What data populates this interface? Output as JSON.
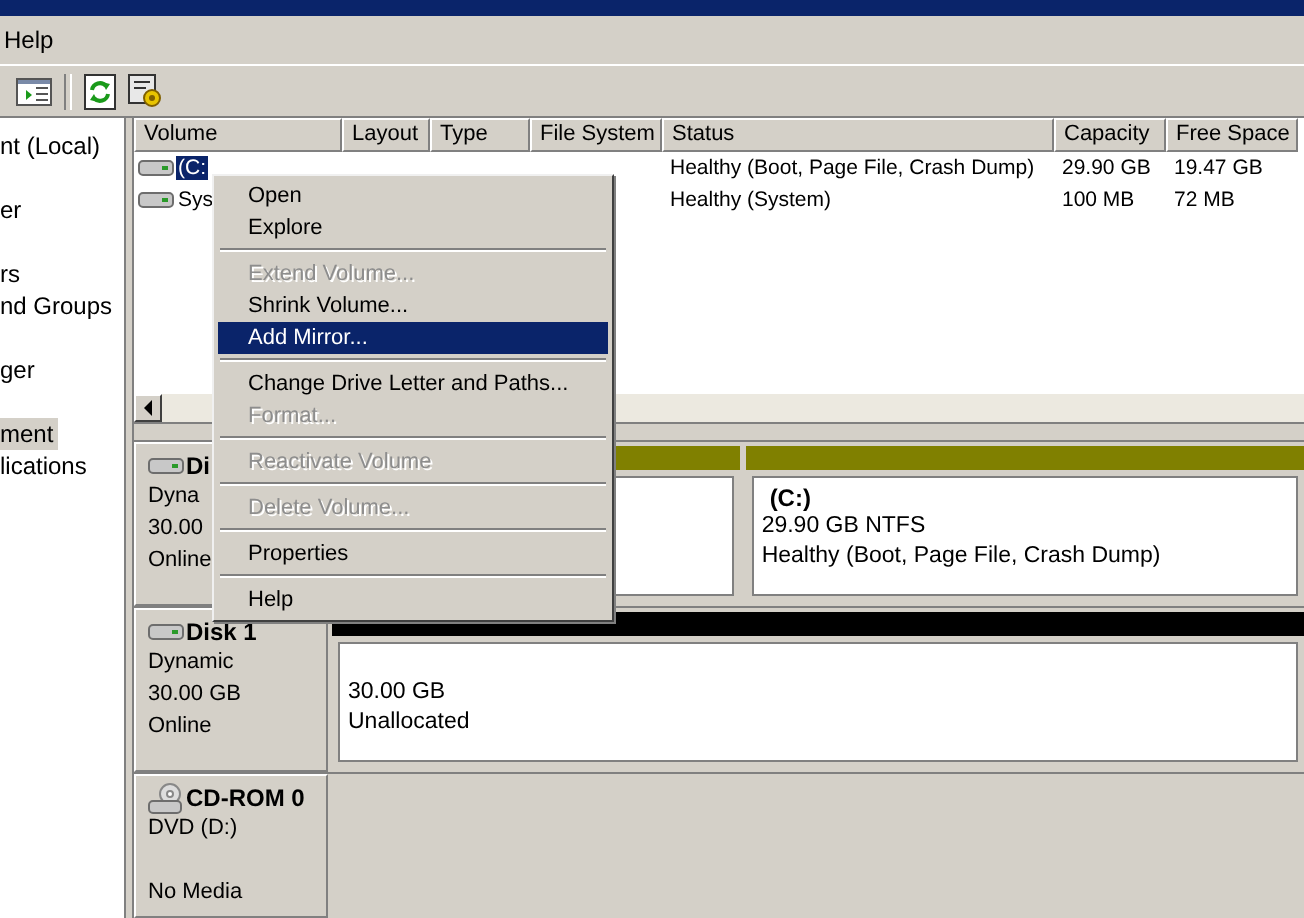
{
  "menu_bar": [
    "Help"
  ],
  "tree": [
    {
      "label": "nt (Local)",
      "selected": false
    },
    {
      "label": "er",
      "selected": false
    },
    {
      "label": "rs",
      "selected": false
    },
    {
      "label": "nd Groups",
      "selected": false
    },
    {
      "label": "ger",
      "selected": false
    },
    {
      "label": "ment",
      "selected": true
    },
    {
      "label": "lications",
      "selected": false
    }
  ],
  "table": {
    "columns": [
      "Volume",
      "Layout",
      "Type",
      "File System",
      "Status",
      "Capacity",
      "Free Space"
    ],
    "rows": [
      {
        "volume": "(C:",
        "status": "Healthy (Boot, Page File, Crash Dump)",
        "capacity": "29.90 GB",
        "free_space": "19.47 GB",
        "selected": true
      },
      {
        "volume": "Sys",
        "status": "Healthy (System)",
        "capacity": "100 MB",
        "free_space": "72 MB",
        "selected": false
      }
    ]
  },
  "disks": [
    {
      "kind": "disk",
      "name": "Di",
      "lines": [
        "Dyna",
        "30.00",
        "Online"
      ],
      "partitions": [
        {
          "color": "#808000"
        },
        {
          "color": "#808000",
          "title": "(C:)",
          "lines": [
            "29.90 GB NTFS",
            "Healthy (Boot, Page File, Crash Dump)"
          ]
        }
      ]
    },
    {
      "kind": "disk",
      "name": "Disk 1",
      "lines": [
        "Dynamic",
        "30.00 GB",
        "Online"
      ],
      "partitions": [
        {
          "color": "#000000",
          "lines": [
            "30.00 GB",
            "Unallocated"
          ]
        }
      ]
    },
    {
      "kind": "cdrom",
      "name": "CD-ROM 0",
      "lines": [
        "DVD (D:)",
        "No Media"
      ]
    }
  ],
  "context_menu": [
    {
      "kind": "item",
      "label": "Open",
      "disabled": false,
      "selected": false
    },
    {
      "kind": "item",
      "label": "Explore",
      "disabled": false,
      "selected": false
    },
    {
      "kind": "separator"
    },
    {
      "kind": "item",
      "label": "Extend Volume...",
      "disabled": true,
      "selected": false
    },
    {
      "kind": "item",
      "label": "Shrink Volume...",
      "disabled": false,
      "selected": false
    },
    {
      "kind": "item",
      "label": "Add Mirror...",
      "disabled": false,
      "selected": true
    },
    {
      "kind": "separator"
    },
    {
      "kind": "item",
      "label": "Change Drive Letter and Paths...",
      "disabled": false,
      "selected": false
    },
    {
      "kind": "item",
      "label": "Format...",
      "disabled": true,
      "selected": false
    },
    {
      "kind": "separator"
    },
    {
      "kind": "item",
      "label": "Reactivate Volume",
      "disabled": true,
      "selected": false
    },
    {
      "kind": "separator"
    },
    {
      "kind": "item",
      "label": "Delete Volume...",
      "disabled": true,
      "selected": false
    },
    {
      "kind": "separator"
    },
    {
      "kind": "item",
      "label": "Properties",
      "disabled": false,
      "selected": false
    },
    {
      "kind": "separator"
    },
    {
      "kind": "item",
      "label": "Help",
      "disabled": false,
      "selected": false
    }
  ]
}
